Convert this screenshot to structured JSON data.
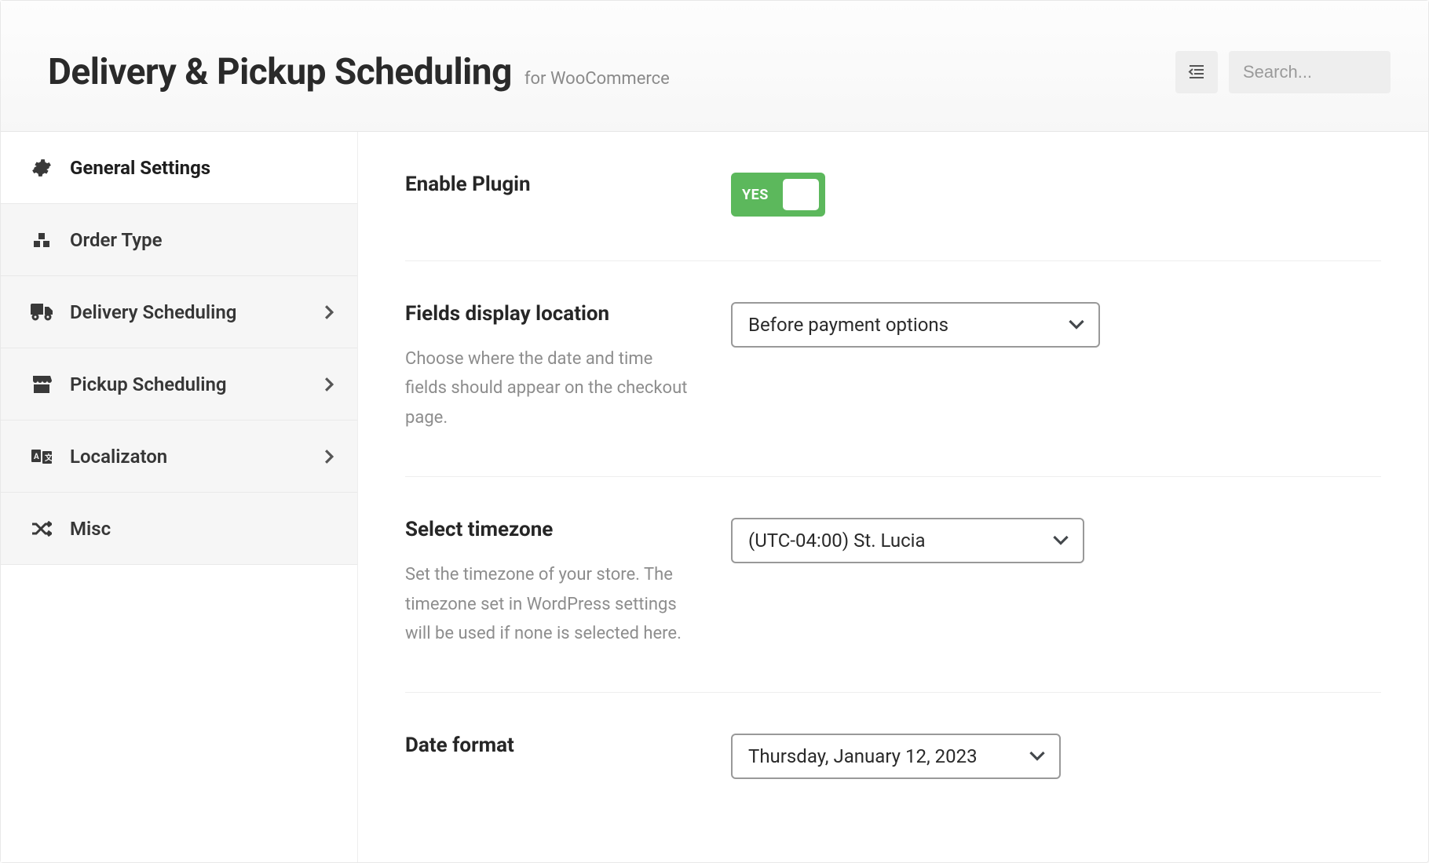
{
  "header": {
    "title": "Delivery & Pickup Scheduling",
    "subtitle": "for WooCommerce",
    "search_placeholder": "Search..."
  },
  "sidebar": {
    "items": [
      {
        "label": "General Settings",
        "has_chevron": false,
        "active": true
      },
      {
        "label": "Order Type",
        "has_chevron": false,
        "active": false
      },
      {
        "label": "Delivery Scheduling",
        "has_chevron": true,
        "active": false
      },
      {
        "label": "Pickup Scheduling",
        "has_chevron": true,
        "active": false
      },
      {
        "label": "Localizaton",
        "has_chevron": true,
        "active": false
      },
      {
        "label": "Misc",
        "has_chevron": false,
        "active": false
      }
    ]
  },
  "settings": {
    "enable_plugin": {
      "label": "Enable Plugin",
      "toggle_text": "YES",
      "value": true
    },
    "fields_display": {
      "label": "Fields display location",
      "description": "Choose where the date and time fields should appear on the checkout page.",
      "selected": "Before payment options"
    },
    "timezone": {
      "label": "Select timezone",
      "description": "Set the timezone of your store. The timezone set in WordPress settings will be used if none is selected here.",
      "selected": "(UTC-04:00) St. Lucia"
    },
    "date_format": {
      "label": "Date format",
      "selected": "Thursday, January 12, 2023"
    }
  }
}
